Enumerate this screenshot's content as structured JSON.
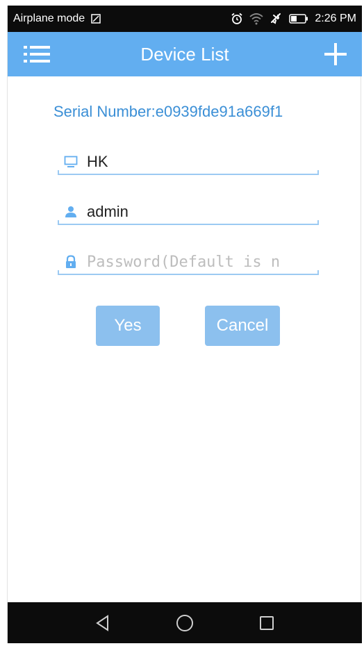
{
  "status_bar": {
    "left_text": "Airplane mode",
    "time": "2:26 PM",
    "icons": [
      "sim-icon",
      "alarm-icon",
      "wifi-icon",
      "airplane-icon",
      "battery-icon"
    ]
  },
  "app_bar": {
    "title": "Device List",
    "left_icon": "menu-list-icon",
    "right_icon": "plus-icon",
    "color": "#62aef0"
  },
  "form": {
    "serial_label": "Serial Number:e0939fde91a669f1",
    "device_name": {
      "value": "HK",
      "icon": "monitor-icon"
    },
    "username": {
      "value": "admin",
      "icon": "user-icon"
    },
    "password": {
      "value": "",
      "placeholder": "Password(Default is n",
      "icon": "lock-icon"
    },
    "accent": "#3b8fd6"
  },
  "buttons": {
    "yes_label": "Yes",
    "cancel_label": "Cancel",
    "color": "#8cc0ee"
  },
  "nav_bar": {
    "icons": [
      "back-triangle-icon",
      "home-circle-icon",
      "recents-square-icon"
    ]
  }
}
